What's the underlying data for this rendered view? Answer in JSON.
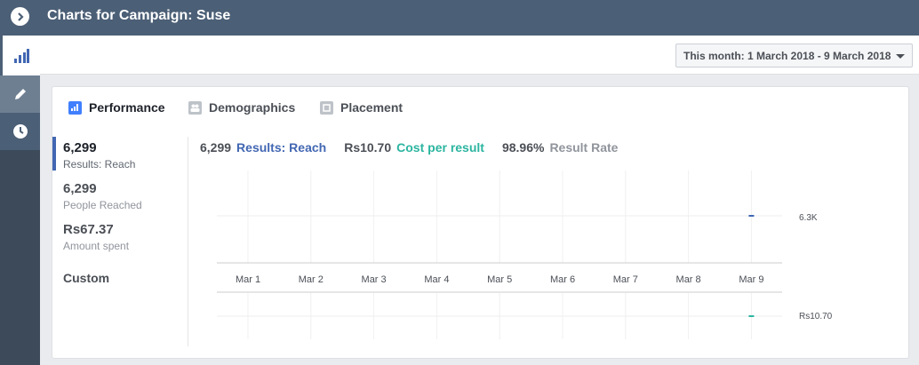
{
  "header": {
    "title": "Charts for Campaign: Suse"
  },
  "date_range": {
    "label": "This month: 1 March 2018 - 9 March 2018"
  },
  "tabs": [
    {
      "label": "Performance",
      "icon": "bar-chart-icon"
    },
    {
      "label": "Demographics",
      "icon": "people-icon"
    },
    {
      "label": "Placement",
      "icon": "placement-icon"
    }
  ],
  "metrics": [
    {
      "value": "6,299",
      "label": "Results: Reach"
    },
    {
      "value": "6,299",
      "label": "People Reached"
    },
    {
      "value": "Rs67.37",
      "label": "Amount spent"
    }
  ],
  "custom_label": "Custom",
  "summary": [
    {
      "value": "6,299",
      "label": "Results: Reach",
      "color": "#4267b2"
    },
    {
      "value": "Rs10.70",
      "label": "Cost per result",
      "color": "#2cb5a0"
    },
    {
      "value": "98.96%",
      "label": "Result Rate",
      "color": "#90949c"
    }
  ],
  "colors": {
    "topbar": "#4b5f76",
    "accent": "#4267b2",
    "teal": "#2cb5a0"
  },
  "chart_data": [
    {
      "type": "line",
      "categories": [
        "Mar 1",
        "Mar 2",
        "Mar 3",
        "Mar 4",
        "Mar 5",
        "Mar 6",
        "Mar 7",
        "Mar 8",
        "Mar 9"
      ],
      "series": [
        {
          "name": "Results: Reach",
          "values": [
            null,
            null,
            null,
            null,
            null,
            null,
            null,
            null,
            6300
          ],
          "color": "#4267b2"
        }
      ],
      "value_label": "6.3K",
      "ylim": [
        0,
        6300
      ]
    },
    {
      "type": "line",
      "categories": [
        "Mar 1",
        "Mar 2",
        "Mar 3",
        "Mar 4",
        "Mar 5",
        "Mar 6",
        "Mar 7",
        "Mar 8",
        "Mar 9"
      ],
      "series": [
        {
          "name": "Cost per result",
          "values": [
            null,
            null,
            null,
            null,
            null,
            null,
            null,
            null,
            10.7
          ],
          "color": "#2cb5a0"
        }
      ],
      "value_label": "Rs10.70",
      "ylim": [
        0,
        10.7
      ]
    }
  ]
}
